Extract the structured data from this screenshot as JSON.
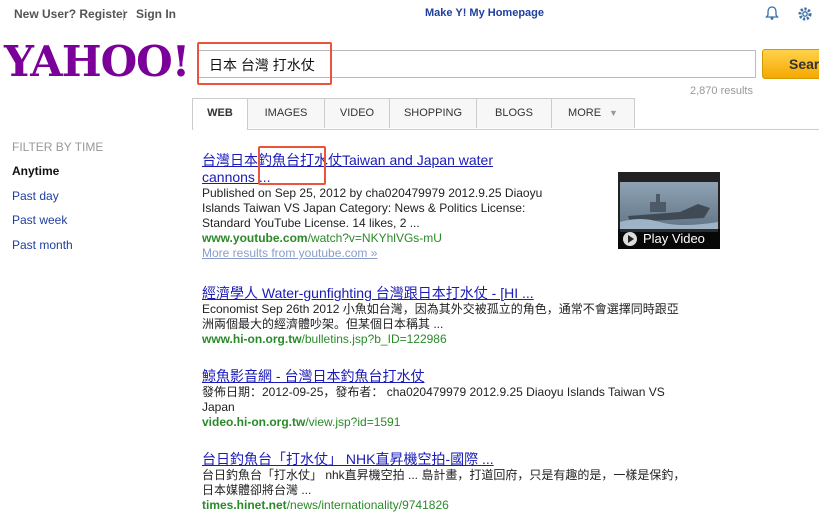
{
  "topbar": {
    "new_user": "New User? Register",
    "sep": "|",
    "sign_in": "Sign In",
    "make_y": "Make Y! My Homepage"
  },
  "logo": "YAHOO!",
  "search": {
    "query": "日本 台灣 打水仗",
    "button": "Search",
    "result_count": "2,870 results"
  },
  "tabs": [
    "WEB",
    "IMAGES",
    "VIDEO",
    "SHOPPING",
    "BLOGS",
    "MORE"
  ],
  "filter": {
    "title": "FILTER BY TIME",
    "items": [
      "Anytime",
      "Past day",
      "Past week",
      "Past month"
    ]
  },
  "results": [
    {
      "title_line1": "台灣日本釣魚台打水仗Taiwan and Japan water",
      "title_line2": "cannons ...",
      "snippet_line1": "Published on Sep 25, 2012 by cha020479979 2012.9.25 Diaoyu",
      "snippet_line2": "Islands Taiwan VS Japan Category: News & Politics License:",
      "snippet_line3": "Standard YouTube License. 14 likes, 2 ...",
      "url_bold": "www.youtube.com",
      "url_rest": "/watch?v=NKYhlVGs-mU",
      "more": "More results from youtube.com »",
      "thumb_label": "Play Video"
    },
    {
      "title_line1": "經濟學人 Water-gunfighting 台灣跟日本打水仗 - [HI ...",
      "snippet_line1": "Economist Sep 26th 2012 小魚如台灣，因為其外交被孤立的角色，通常不會選擇同時跟亞",
      "snippet_line2": "洲兩個最大的經濟體吵架。但某個日本稱其 ...",
      "url_bold": "www.hi-on.org.tw",
      "url_rest": "/bulletins.jsp?b_ID=122986"
    },
    {
      "title_line1": "鯨魚影音網 - 台灣日本釣魚台打水仗",
      "snippet_line1": "發佈日期：2012-09-25，發布者： cha020479979 2012.9.25 Diaoyu Islands Taiwan VS",
      "snippet_line2": "Japan",
      "url_bold": "video.hi-on.org.tw",
      "url_rest": "/view.jsp?id=1591"
    },
    {
      "title_line1": "台日釣魚台「打水仗」 NHK直昇機空拍-國際 ...",
      "snippet_line1": "台日釣魚台「打水仗」 nhk直昇機空拍 ... 島計畫，打道回府，只是有趣的是，一樣是保釣，",
      "snippet_line2": "日本媒體卻將台灣 ...",
      "url_bold": "times.hinet.net",
      "url_rest": "/news/internationality/9741826"
    }
  ],
  "colors": {
    "logo": "#7b0099",
    "link": "#1a1ab8",
    "url": "#2a8a2a",
    "highlight": "#e8553c"
  }
}
